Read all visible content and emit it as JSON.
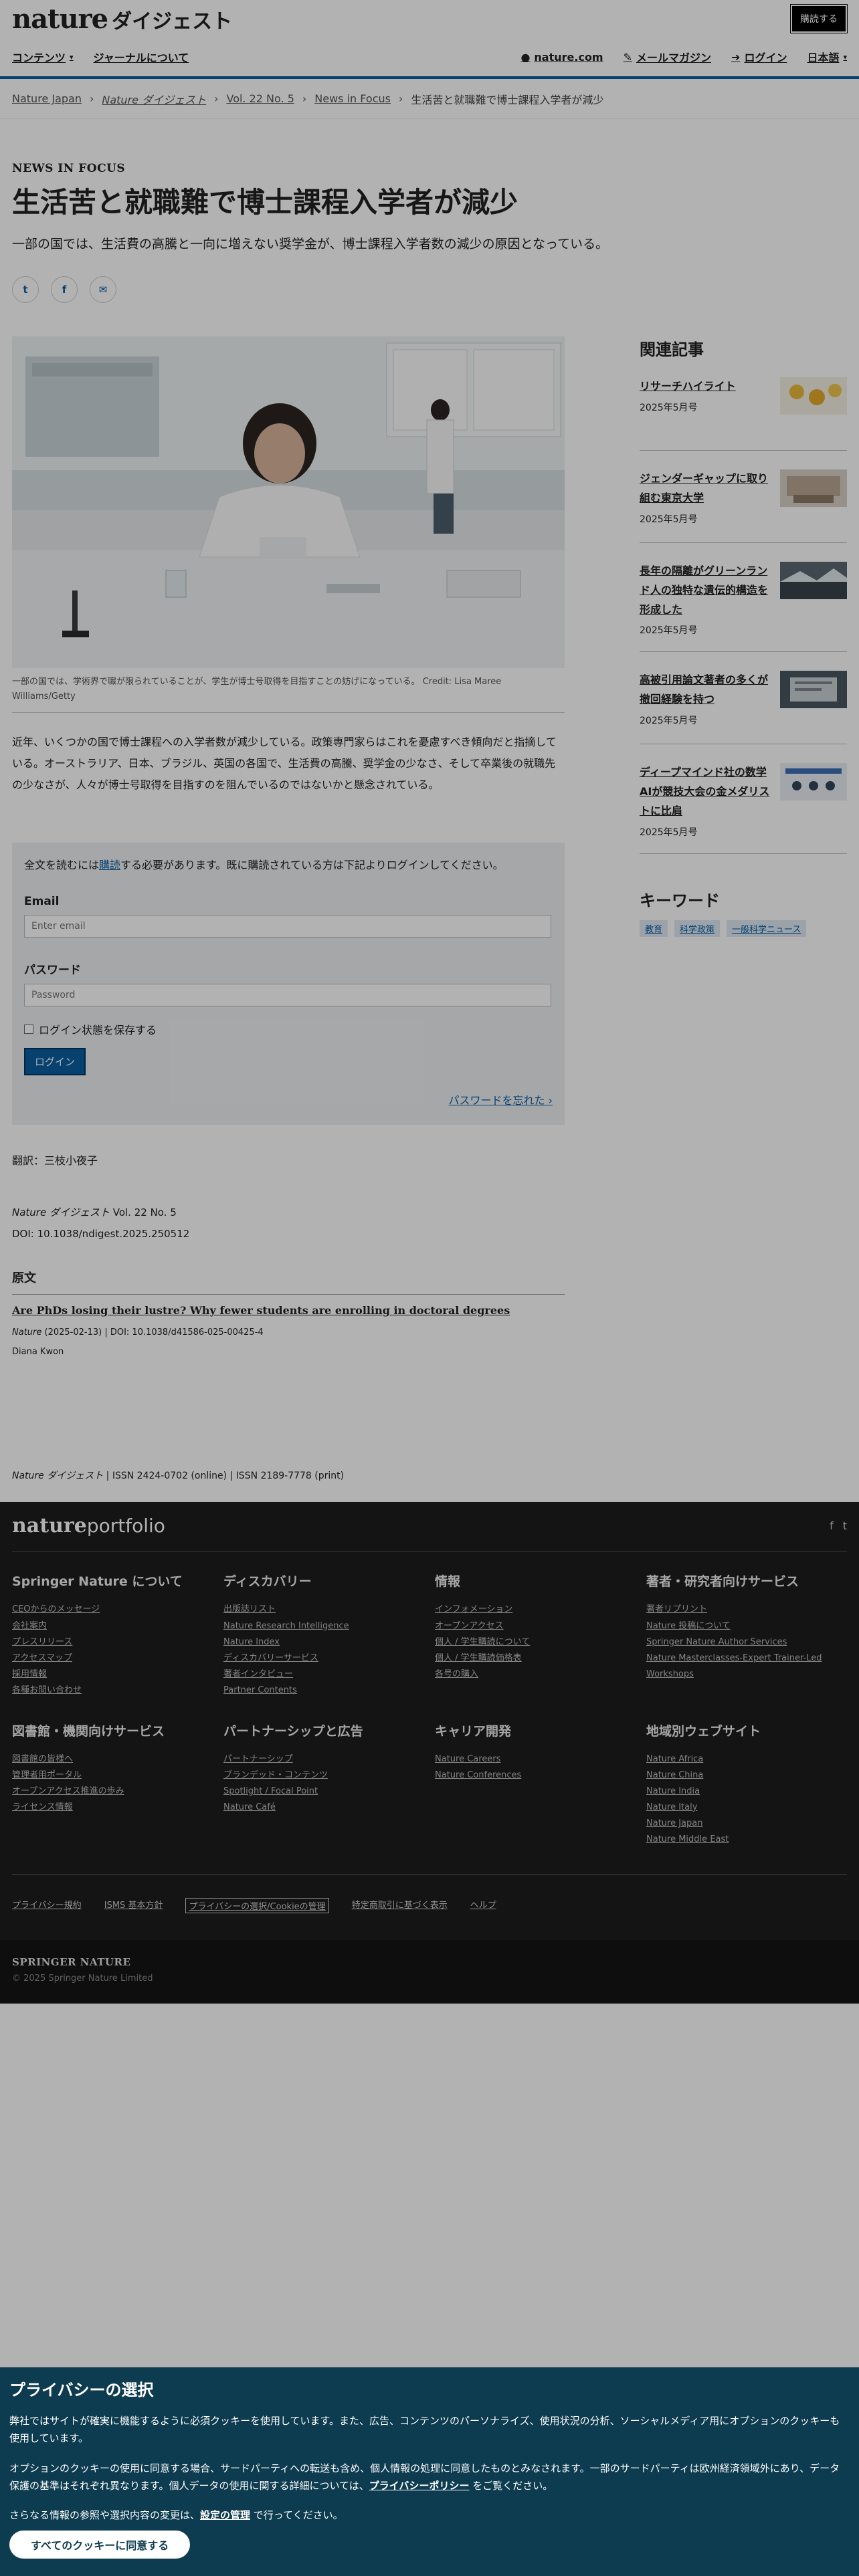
{
  "header": {
    "logo_en": "nature",
    "logo_jp": "ダイジェスト",
    "subscribe": "購読する"
  },
  "nav": {
    "contents": "コンテンツ",
    "about": "ジャーナルについて",
    "nature_com": "nature.com",
    "mail_magazine": "メールマガジン",
    "login": "ログイン",
    "language": "日本語"
  },
  "breadcrumb": [
    "Nature Japan",
    "Nature ダイジェスト",
    "Vol. 22 No. 5",
    "News in Focus",
    "生活苦と就職難で博士課程入学者が減少"
  ],
  "article": {
    "kicker": "NEWS IN FOCUS",
    "title": "生活苦と就職難で博士課程入学者が減少",
    "standfirst": "一部の国では、生活費の高騰と一向に増えない奨学金が、博士課程入学者数の減少の原因となっている。",
    "share": [
      "t",
      "f",
      "✉"
    ],
    "figure_caption": "一部の国では、学術界で職が限られていることが、学生が博士号取得を目指すことの妨げになっている。 Credit: Lisa Maree Williams/Getty",
    "body": "近年、いくつかの国で博士課程への入学者数が減少している。政策専門家らはこれを憂慮すべき傾向だと指摘している。オーストラリア、日本、ブラジル、英国の各国で、生活費の高騰、奨学金の少なさ、そして卒業後の就職先の少なさが、人々が博士号取得を目指すのを阻んでいるのではないかと懸念されている。"
  },
  "login_box": {
    "lead_pre": "全文を読むには",
    "lead_link": "購読",
    "lead_post": "する必要があります。既に購読されている方は下記よりログインしてください。",
    "email_label": "Email",
    "email_placeholder": "Enter email",
    "password_label": "パスワード",
    "password_placeholder": "Password",
    "remember": "ログイン状態を保存する",
    "login_button": "ログイン",
    "forgot": "パスワードを忘れた ›"
  },
  "meta": {
    "translator": "翻訳：三枝小夜子",
    "issue_journal": "Nature ダイジェスト",
    "issue_vol": " Vol. 22 No. 5",
    "doi": "DOI: 10.1038/ndigest.2025.250512",
    "original_heading": "原文",
    "original_title": "Are PhDs losing their lustre? Why fewer students are enrolling in doctoral degrees",
    "original_journal": "Nature",
    "original_ref": " (2025-02-13) | DOI: 10.1038/d41586-025-00425-4",
    "original_author": "Diana Kwon",
    "issn_journal": "Nature ダイジェスト",
    "issn": " | ISSN 2424-0702 (online) | ISSN 2189-7778 (print)"
  },
  "sidebar": {
    "related_title": "関連記事",
    "related": [
      {
        "title": "リサーチハイライト",
        "date": "2025年5月号"
      },
      {
        "title": "ジェンダーギャップに取り組む東京大学",
        "date": "2025年5月号"
      },
      {
        "title": "長年の隔離がグリーンランド人の独特な遺伝的構造を形成した",
        "date": "2025年5月号"
      },
      {
        "title": "高被引用論文著者の多くが撤回経験を持つ",
        "date": "2025年5月号"
      },
      {
        "title": "ディープマインド社の数学AIが競技大会の金メダリストに比肩",
        "date": "2025年5月号"
      }
    ],
    "keywords_title": "キーワード",
    "keywords": [
      "教育",
      "科学政策",
      "一般科学ニュース"
    ]
  },
  "footer": {
    "logo_b": "nature",
    "logo_rest": "portfolio",
    "social": [
      "f",
      "t"
    ],
    "columns": [
      {
        "title": "Springer Nature について",
        "links": [
          "CEOからのメッセージ",
          "会社案内",
          "プレスリリース",
          "アクセスマップ",
          "採用情報",
          "各種お問い合わせ"
        ]
      },
      {
        "title": "ディスカバリー",
        "links": [
          "出版誌リスト",
          "Nature Research Intelligence",
          "Nature Index",
          "ディスカバリーサービス",
          "著者インタビュー",
          "Partner Contents"
        ]
      },
      {
        "title": "情報",
        "links": [
          "インフォメーション",
          "オープンアクセス",
          "個人 / 学生購読について",
          "個人 / 学生購読価格表",
          "各号の購入"
        ]
      },
      {
        "title": "著者・研究者向けサービス",
        "links": [
          "著者リプリント",
          "Nature 投稿について",
          "Springer Nature Author Services",
          "Nature Masterclasses-Expert Trainer-Led Workshops"
        ]
      },
      {
        "title": "図書館・機関向けサービス",
        "links": [
          "図書館の皆様へ",
          "管理者用ポータル",
          "オープンアクセス推進の歩み",
          "ライセンス情報"
        ]
      },
      {
        "title": "パートナーシップと広告",
        "links": [
          "パートナーシップ",
          "ブランデッド・コンテンツ",
          "Spotlight / Focal Point",
          "Nature Café"
        ]
      },
      {
        "title": "キャリア開発",
        "links": [
          "Nature Careers",
          "Nature Conferences"
        ]
      },
      {
        "title": "地域別ウェブサイト",
        "links": [
          "Nature Africa",
          "Nature China",
          "Nature India",
          "Nature Italy",
          "Nature Japan",
          "Nature Middle East"
        ]
      }
    ],
    "bottom_links": [
      "プライバシー規約",
      "ISMS 基本方針",
      "プライバシーの選択/Cookieの管理",
      "特定商取引に基づく表示",
      "ヘルプ"
    ],
    "springer": "SPRINGER NATURE",
    "copyright": "© 2025 Springer Nature Limited"
  },
  "privacy": {
    "title": "プライバシーの選択",
    "p1": "弊社ではサイトが確実に機能するように必須クッキーを使用しています。また、広告、コンテンツのパーソナライズ、使用状況の分析、ソーシャルメディア用にオプションのクッキーも使用しています。",
    "p2_pre": "オプションのクッキーの使用に同意する場合、サードパーティへの転送も含め、個人情報の処理に同意したものとみなされます。一部のサードパーティは欧州経済領域外にあり、データ保護の基準はそれぞれ異なります。個人データの使用に関する詳細については、",
    "p2_link": "プライバシーポリシー",
    "p2_post": " をご覧ください。",
    "p3_pre": "さらなる情報の参照や選択内容の変更は、",
    "p3_link": "設定の管理",
    "p3_post": " で行ってください。",
    "accept": "すべてのクッキーに同意する"
  }
}
